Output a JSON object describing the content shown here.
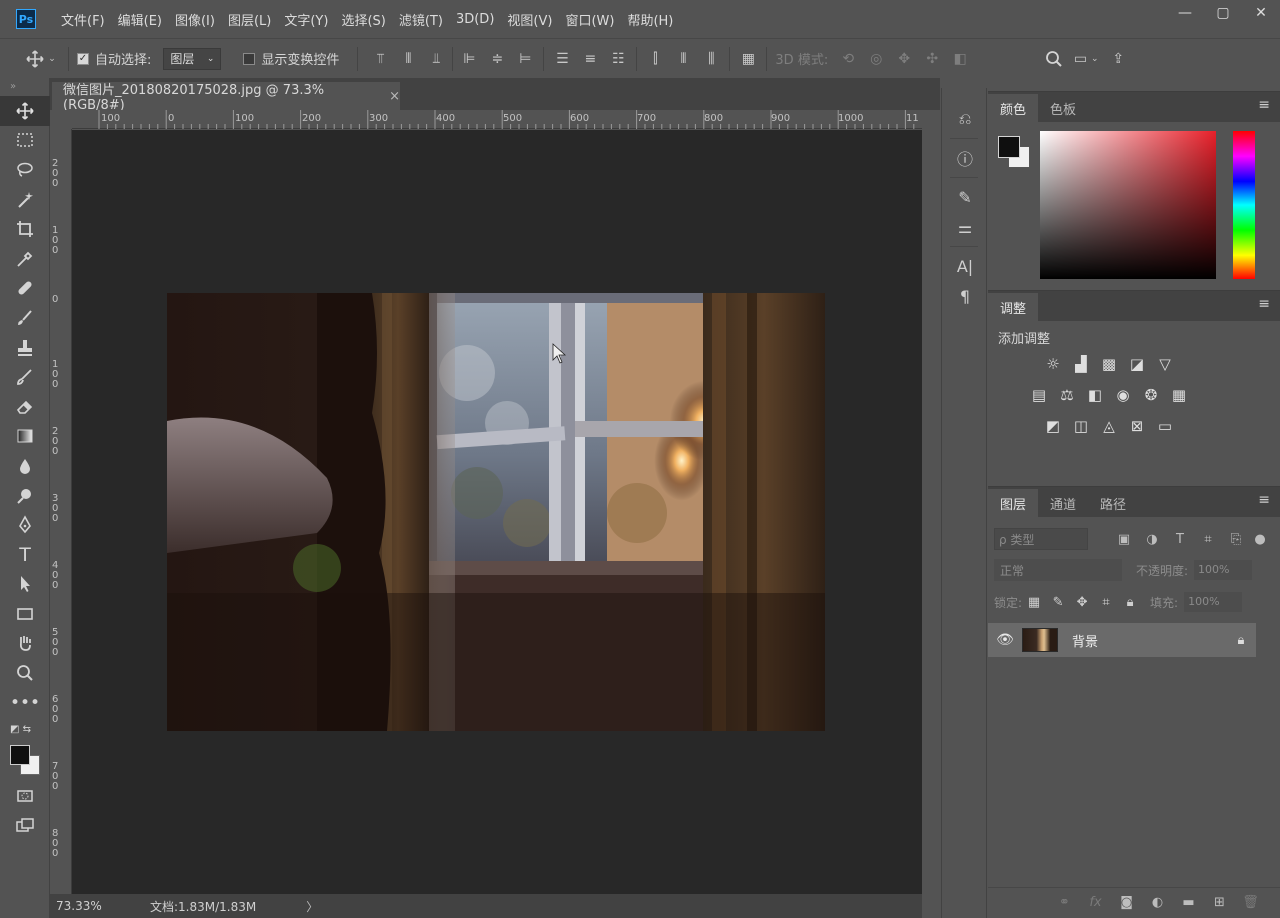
{
  "app": {
    "logo": "Ps"
  },
  "menu": [
    "文件(F)",
    "编辑(E)",
    "图像(I)",
    "图层(L)",
    "文字(Y)",
    "选择(S)",
    "滤镜(T)",
    "3D(D)",
    "视图(V)",
    "窗口(W)",
    "帮助(H)"
  ],
  "window_controls": {
    "minimize": "—",
    "maximize": "▢",
    "close": "✕"
  },
  "options": {
    "auto_select_label": "自动选择:",
    "auto_select_checked": true,
    "auto_select_target": "图层",
    "show_transform_label": "显示变换控件",
    "show_transform_checked": false,
    "mode_3d_label": "3D 模式:"
  },
  "document": {
    "tab_title": "微信图片_20180820175028.jpg @ 73.3%(RGB/8#)",
    "close": "×",
    "ruler_h_labels": [
      "100",
      "0",
      "100",
      "200",
      "300",
      "400",
      "500",
      "600",
      "700",
      "800",
      "900",
      "1000",
      "11"
    ],
    "ruler_v_labels": [
      "2\n0\n0",
      "1\n0\n0",
      "0",
      "1\n0\n0",
      "2\n0\n0",
      "3\n0\n0",
      "4\n0\n0",
      "5\n0\n0",
      "6\n0\n0",
      "7\n0\n0",
      "8\n0\n0"
    ]
  },
  "status": {
    "zoom": "73.33%",
    "doc_info": "文档:1.83M/1.83M",
    "arrow": "〉"
  },
  "panels": {
    "color": {
      "tabs": [
        "颜色",
        "色板"
      ],
      "active": 0,
      "foreground": "#0f0f0f",
      "background": "#f0f0f0"
    },
    "adjustments": {
      "tabs": [
        "调整"
      ],
      "add_label": "添加调整"
    },
    "layers": {
      "tabs": [
        "图层",
        "通道",
        "路径"
      ],
      "filter_placeholder": "ρ 类型",
      "blend_mode": "正常",
      "opacity_label": "不透明度:",
      "opacity_value": "100%",
      "lock_label": "锁定:",
      "fill_label": "填充:",
      "fill_value": "100%",
      "items": [
        {
          "name": "背景",
          "visible": true,
          "locked": true
        }
      ]
    }
  },
  "colors": {
    "panel_bg": "#535353",
    "canvas_bg": "#282828",
    "accent": "#31a8ff"
  }
}
